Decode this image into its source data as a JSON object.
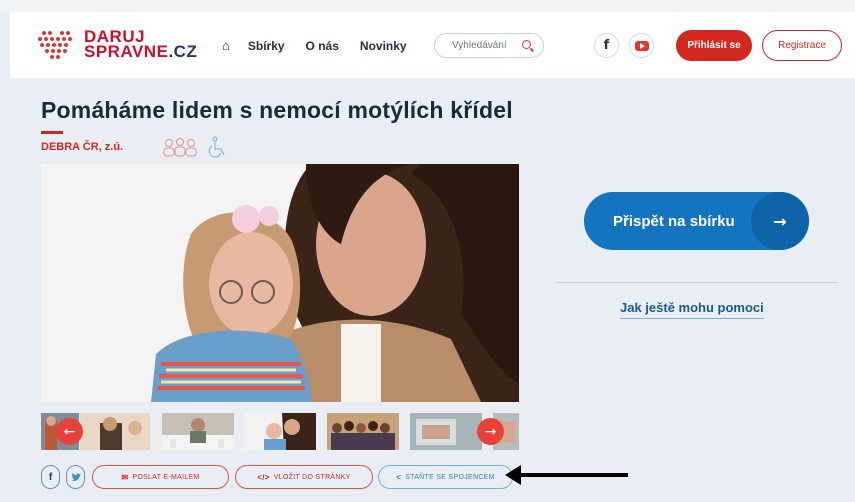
{
  "header": {
    "logo_line1": "DARUJ",
    "logo_line2_a": "SPRAVNE",
    "logo_line2_b": ".CZ",
    "nav": [
      "Sbírky",
      "O nás",
      "Novinky"
    ],
    "search_placeholder": "Vyhledávání",
    "login_label": "Přihlásit se",
    "register_label": "Registrace",
    "social": [
      "facebook-icon",
      "youtube-icon"
    ]
  },
  "page": {
    "title": "Pomáháme lidem s nemocí motýlích křídel",
    "organization": "DEBRA ČR, z.ú."
  },
  "gallery": {
    "thumbnail_count": 6,
    "prev_icon": "arrow-left-icon",
    "next_icon": "arrow-right-icon"
  },
  "share": {
    "email_label": "POSLAT E-MAILEM",
    "embed_label": "VLOŽIT DO STRÁNKY",
    "connect_label": "STAŇTE SE SPOJENCEM"
  },
  "sidebar": {
    "donate_label": "Přispět na sbírku",
    "help_label": "Jak ještě mohu pomoci"
  },
  "colors": {
    "brand_red": "#d3281f",
    "brand_blue": "#1474bf",
    "background": "#e8eef4"
  }
}
